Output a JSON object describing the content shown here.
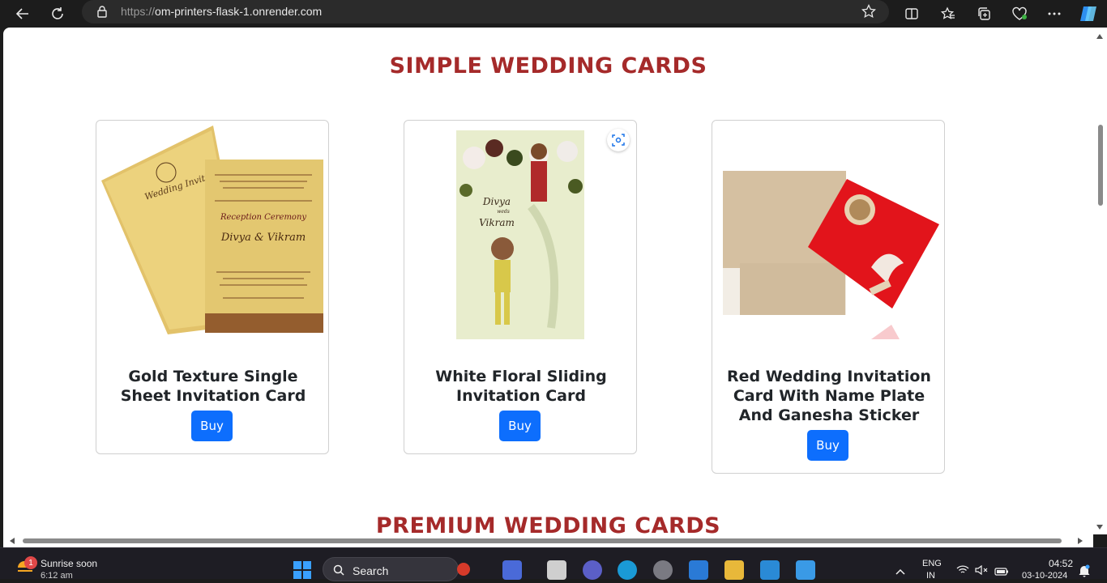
{
  "browser": {
    "url_scheme": "https://",
    "url_host": "om-printers-flask-1.onrender.com",
    "icons": [
      "back-icon",
      "refresh-icon",
      "lock-icon",
      "favorite-star-icon",
      "split-screen-icon",
      "favorites-icon",
      "collections-icon",
      "browser-essentials-icon",
      "more-icon",
      "copilot-icon"
    ]
  },
  "page": {
    "section1_title": "SIMPLE WEDDING CARDS",
    "section2_title": "PREMIUM WEDDING CARDS",
    "cards": [
      {
        "title": "Gold Texture Single Sheet Invitation Card",
        "button": "Buy",
        "image_text": {
          "left": "Wedding Invitation",
          "right_names": "Divya & Vikram",
          "right_ceremony": "Reception Ceremony"
        }
      },
      {
        "title": "White Floral Sliding Invitation Card",
        "button": "Buy",
        "image_text": {
          "names1": "Divya",
          "weds": "weds",
          "names2": "Vikram"
        }
      },
      {
        "title": "Red Wedding Invitation Card With Name Plate And Ganesha Sticker",
        "button": "Buy"
      }
    ]
  },
  "taskbar": {
    "weather_title": "Sunrise soon",
    "weather_sub": "6:12 am",
    "notification_count": "1",
    "search_label": "Search",
    "lang_top": "ENG",
    "lang_bottom": "IN",
    "time": "04:52",
    "date": "03-10-2024"
  }
}
